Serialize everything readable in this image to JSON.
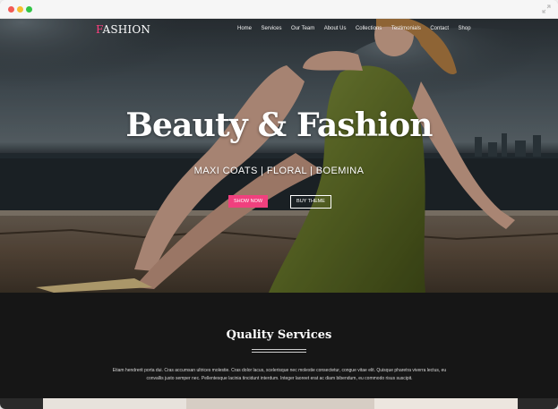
{
  "brand": {
    "logo_accent": "F",
    "logo_rest": "ASHION",
    "accent_color": "#ff3f7f"
  },
  "nav": {
    "items": [
      "Home",
      "Services",
      "Our Team",
      "About Us",
      "Collections",
      "Testimonials",
      "Contact",
      "Shop"
    ]
  },
  "hero": {
    "title": "Beauty & Fashion",
    "subtitle": "MAXI COATS | FLORAL | BOEMINA",
    "primary_button": "SHOW NOW",
    "secondary_button": "BUY THEME",
    "button_color": "#f0407e"
  },
  "services": {
    "title": "Quality Services",
    "text_line1": "Etiam hendrerit porta dui. Cras accumsan ultrices molestie. Cras dolor lacus, scelerisque nec molestie consectetur, congue vitae elit. Quisque pharetra viverra lectus, eu",
    "text_line2": "convallis justo semper nec. Pellentesque lacinia tincidunt interdum. Integer laoreet erat ac diam bibendum, eu commodo risus suscipit."
  },
  "icons": {
    "window_controls": [
      "close-dot",
      "minimize-dot",
      "zoom-dot"
    ],
    "expand": "expand-icon"
  }
}
